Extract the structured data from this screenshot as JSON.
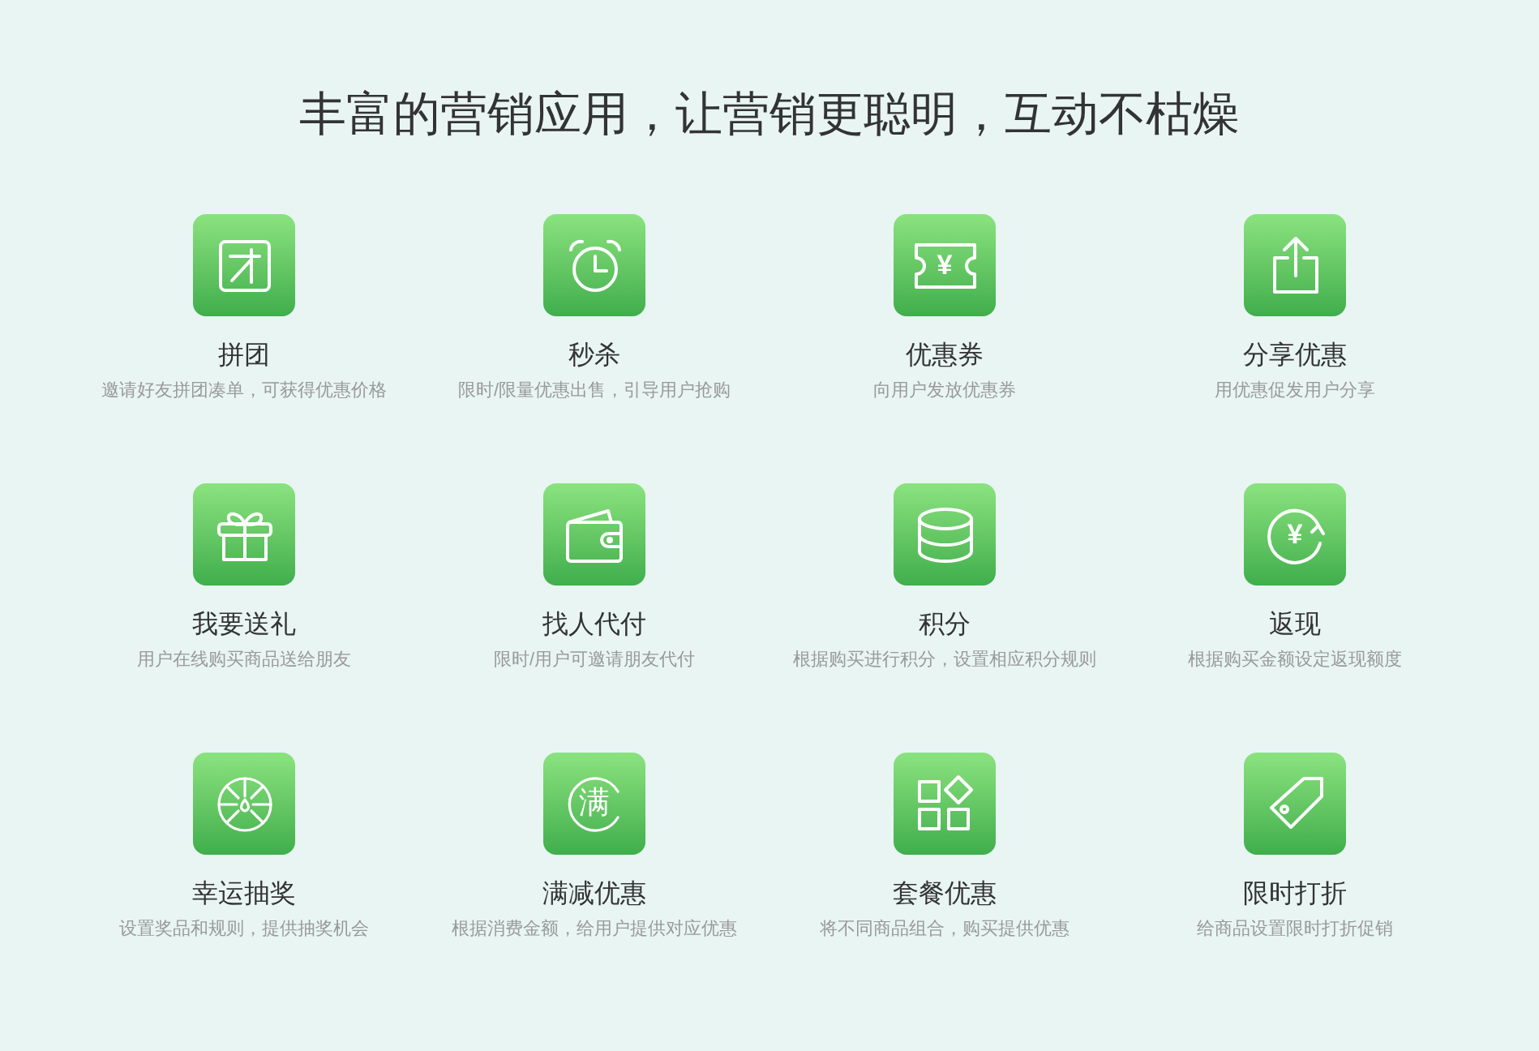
{
  "heading": "丰富的营销应用，让营销更聪明，互动不枯燥",
  "features": [
    {
      "kind": "group",
      "name": "拼团",
      "desc": "邀请好友拼团凑单，可获得优惠价格"
    },
    {
      "kind": "alarm",
      "name": "秒杀",
      "desc": "限时/限量优惠出售，引导用户抢购"
    },
    {
      "kind": "coupon",
      "glyph": "¥",
      "name": "优惠券",
      "desc": "向用户发放优惠券"
    },
    {
      "kind": "share",
      "name": "分享优惠",
      "desc": "用优惠促发用户分享"
    },
    {
      "kind": "gift",
      "name": "我要送礼",
      "desc": "用户在线购买商品送给朋友"
    },
    {
      "kind": "wallet",
      "name": "找人代付",
      "desc": "限时/用户可邀请朋友代付"
    },
    {
      "kind": "coins",
      "name": "积分",
      "desc": "根据购买进行积分，设置相应积分规则"
    },
    {
      "kind": "refund",
      "glyph": "¥",
      "name": "返现",
      "desc": "根据购买金额设定返现额度"
    },
    {
      "kind": "wheel",
      "name": "幸运抽奖",
      "desc": "设置奖品和规则，提供抽奖机会"
    },
    {
      "kind": "full",
      "glyph": "满",
      "name": "满减优惠",
      "desc": "根据消费金额，给用户提供对应优惠"
    },
    {
      "kind": "combo",
      "name": "套餐优惠",
      "desc": "将不同商品组合，购买提供优惠"
    },
    {
      "kind": "tag",
      "name": "限时打折",
      "desc": "给商品设置限时打折促销"
    }
  ]
}
